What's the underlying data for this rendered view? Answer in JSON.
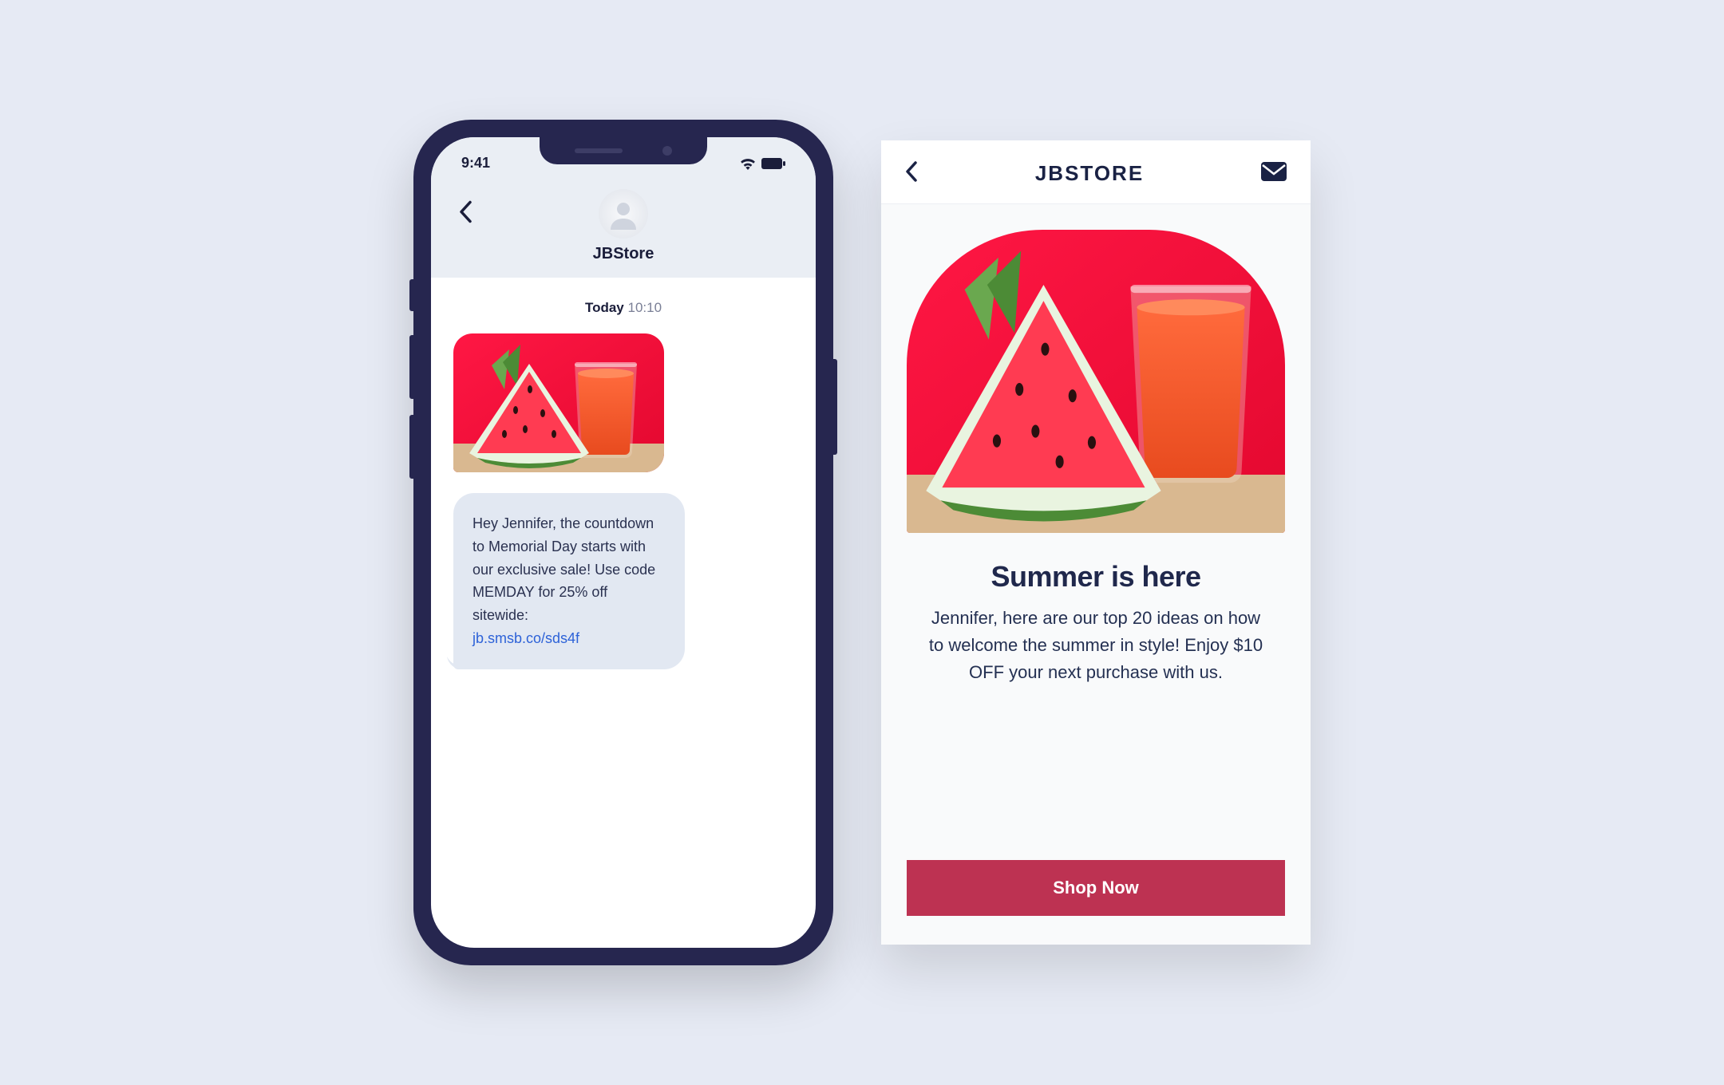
{
  "phone": {
    "status": {
      "time": "9:41"
    },
    "back_icon": "back",
    "contact_name": "JBStore",
    "timestamp": {
      "day": "Today",
      "time": "10:10"
    },
    "message": {
      "text": "Hey Jennifer, the countdown to Memorial Day starts with our exclusive sale! Use code MEMDAY for 25% off sitewide:",
      "link": "jb.smsb.co/sds4f"
    }
  },
  "email": {
    "brand": "JBSTORE",
    "headline": "Summer is here",
    "subcopy": "Jennifer, here are our top 20 ideas on how to welcome the summer in style! Enjoy $10 OFF your next purchase with us.",
    "cta": "Shop Now"
  }
}
